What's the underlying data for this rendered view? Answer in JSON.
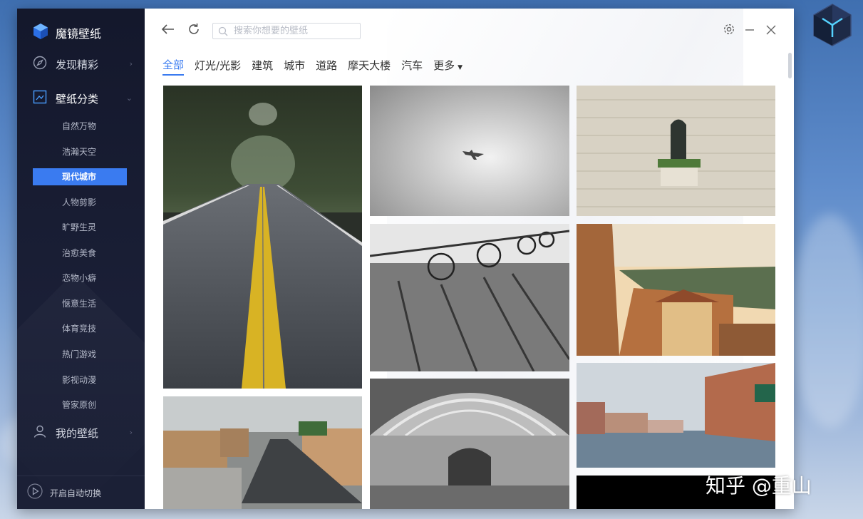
{
  "app": {
    "title": "魔镜壁纸"
  },
  "sidebar": {
    "nav": {
      "discover": "发现精彩",
      "categories": "壁纸分类",
      "mine": "我的壁纸"
    },
    "subitems": [
      "自然万物",
      "浩瀚天空",
      "现代城市",
      "人物剪影",
      "旷野生灵",
      "治愈美食",
      "恋物小癖",
      "惬意生活",
      "体育竞技",
      "热门游戏",
      "影视动漫",
      "管家原创"
    ],
    "active_subitem": "现代城市",
    "footer": {
      "auto_switch": "开启自动切换"
    }
  },
  "toolbar": {
    "search_placeholder": "搜索你想要的壁纸"
  },
  "tabs": [
    "全部",
    "灯光/光影",
    "建筑",
    "城市",
    "道路",
    "摩天大楼",
    "汽车",
    "更多"
  ],
  "active_tab": "全部",
  "gallery": {
    "images": [
      "road-between-trees",
      "airplane-in-cloudy-sky",
      "stone-wall-window-flowers",
      "bicycles-shadows-bw",
      "hillside-old-town",
      "old-city-street-aerial",
      "arched-glass-gallery",
      "venice-canal",
      "black-image"
    ]
  },
  "watermark": "知乎 @重山",
  "colors": {
    "accent": "#3a7bf0",
    "sidebar_bg": "#161a2e"
  }
}
